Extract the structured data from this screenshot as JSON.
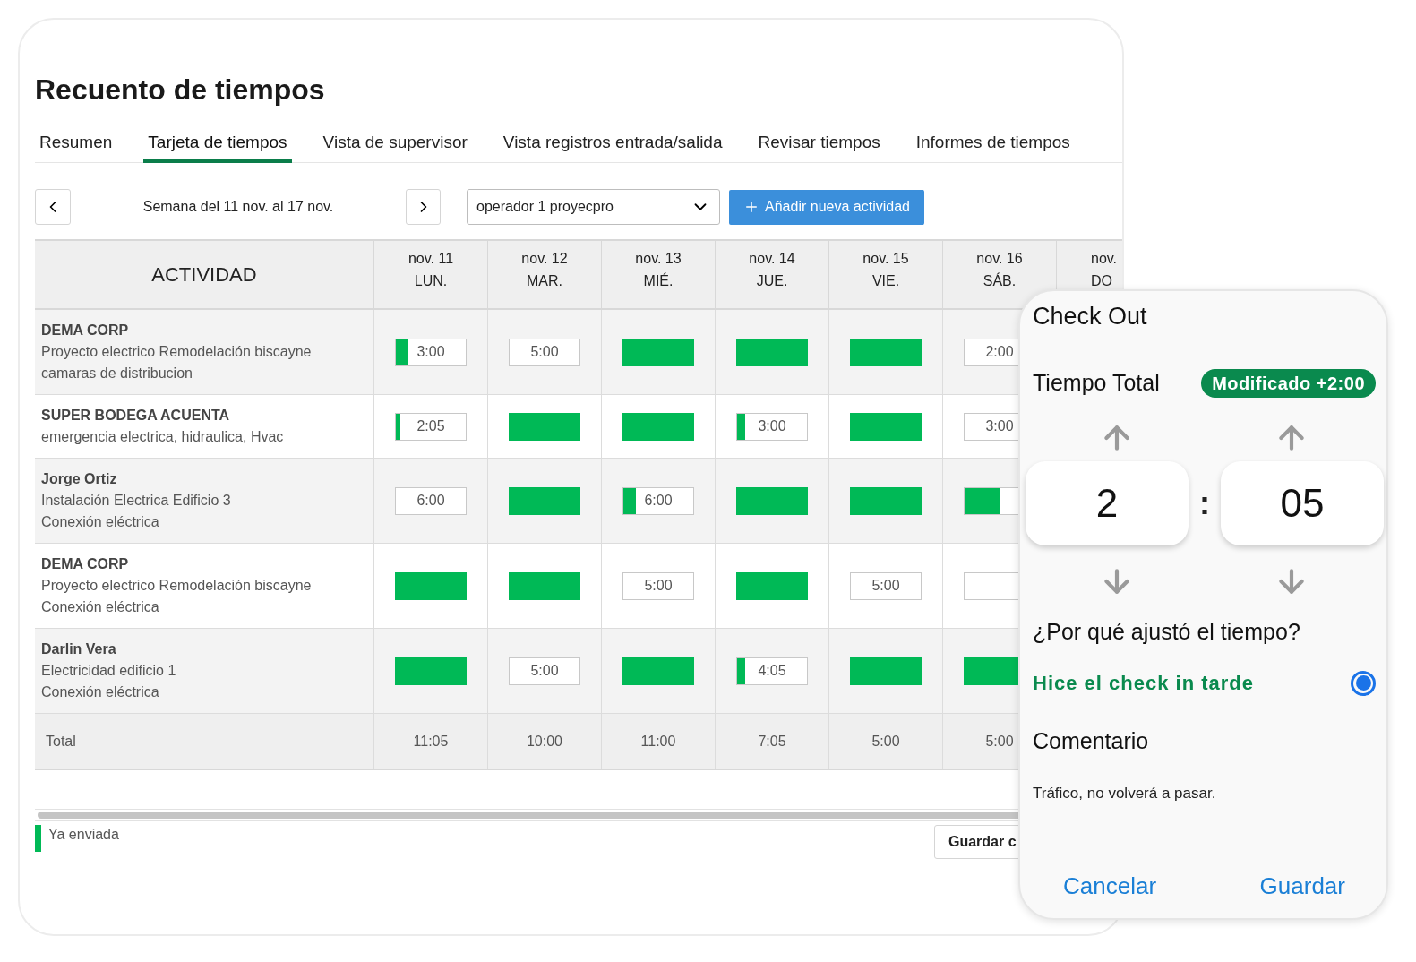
{
  "title": "Recuento de tiempos",
  "tabs": [
    {
      "label": "Resumen",
      "selected": false
    },
    {
      "label": "Tarjeta de tiempos",
      "selected": true
    },
    {
      "label": "Vista de supervisor",
      "selected": false
    },
    {
      "label": "Vista registros entrada/salida",
      "selected": false
    },
    {
      "label": "Revisar tiempos",
      "selected": false
    },
    {
      "label": "Informes de tiempos",
      "selected": false
    }
  ],
  "week_label": "Semana del 11 nov. al 17 nov.",
  "operator_select": {
    "value": "operador 1 proyecpro"
  },
  "add_button": {
    "label": "Añadir nueva actividad"
  },
  "table": {
    "activity_header": "ACTIVIDAD",
    "days": [
      {
        "date": "nov. 11",
        "day": "LUN."
      },
      {
        "date": "nov. 12",
        "day": "MAR."
      },
      {
        "date": "nov. 13",
        "day": "MIÉ."
      },
      {
        "date": "nov. 14",
        "day": "JUE."
      },
      {
        "date": "nov. 15",
        "day": "VIE."
      },
      {
        "date": "nov. 16",
        "day": "SÁB."
      },
      {
        "date": "nov.",
        "day": "DO"
      }
    ],
    "rows": [
      {
        "client": "DEMA CORP",
        "lines": [
          "Proyecto electrico Remodelación biscayne",
          "camaras de distribucion"
        ],
        "cells": [
          {
            "kind": "partial",
            "value": "3:00",
            "level": 0.18
          },
          {
            "kind": "entry",
            "value": "5:00"
          },
          {
            "kind": "submitted"
          },
          {
            "kind": "submitted"
          },
          {
            "kind": "submitted"
          },
          {
            "kind": "entry",
            "value": "2:00"
          }
        ]
      },
      {
        "client": "SUPER BODEGA ACUENTA",
        "lines": [
          "emergencia electrica, hidraulica, Hvac"
        ],
        "cells": [
          {
            "kind": "partial",
            "value": "2:05",
            "level": 0.06
          },
          {
            "kind": "submitted"
          },
          {
            "kind": "submitted"
          },
          {
            "kind": "partial",
            "value": "3:00",
            "level": 0.12
          },
          {
            "kind": "submitted"
          },
          {
            "kind": "entry",
            "value": "3:00"
          }
        ]
      },
      {
        "client": "Jorge Ortiz",
        "lines": [
          "Instalación Electrica Edificio 3",
          "Conexión eléctrica"
        ],
        "cells": [
          {
            "kind": "entry",
            "value": "6:00"
          },
          {
            "kind": "submitted"
          },
          {
            "kind": "partial",
            "value": "6:00",
            "level": 0.18
          },
          {
            "kind": "submitted"
          },
          {
            "kind": "submitted"
          },
          {
            "kind": "partial",
            "level": 0.5
          }
        ]
      },
      {
        "client": "DEMA CORP",
        "lines": [
          "Proyecto electrico Remodelación biscayne",
          "Conexión eléctrica"
        ],
        "cells": [
          {
            "kind": "submitted"
          },
          {
            "kind": "submitted"
          },
          {
            "kind": "entry",
            "value": "5:00"
          },
          {
            "kind": "submitted"
          },
          {
            "kind": "entry",
            "value": "5:00"
          },
          {
            "kind": "entry"
          }
        ]
      },
      {
        "client": "Darlin Vera",
        "lines": [
          "Electricidad edificio 1",
          "Conexión eléctrica"
        ],
        "cells": [
          {
            "kind": "submitted"
          },
          {
            "kind": "entry",
            "value": "5:00"
          },
          {
            "kind": "submitted"
          },
          {
            "kind": "partial",
            "value": "4:05",
            "level": 0.12
          },
          {
            "kind": "submitted"
          },
          {
            "kind": "submitted"
          }
        ]
      }
    ],
    "total_label": "Total",
    "totals": [
      "11:05",
      "10:00",
      "11:00",
      "7:05",
      "5:00",
      "5:00"
    ]
  },
  "legend": {
    "label": "Ya enviada"
  },
  "save_button": {
    "label": "Guardar c"
  },
  "popup": {
    "title": "Check Out",
    "total_label": "Tiempo Total",
    "badge": "Modificado +2:00",
    "hours": "2",
    "separator": ":",
    "minutes": "05",
    "question": "¿Por qué ajustó el tiempo?",
    "options": [
      {
        "label": "Hice el check in tarde",
        "selected": true
      }
    ],
    "comment_label": "Comentario",
    "comment": "Tráfico, no volverá a pasar.",
    "cancel": "Cancelar",
    "save": "Guardar"
  }
}
